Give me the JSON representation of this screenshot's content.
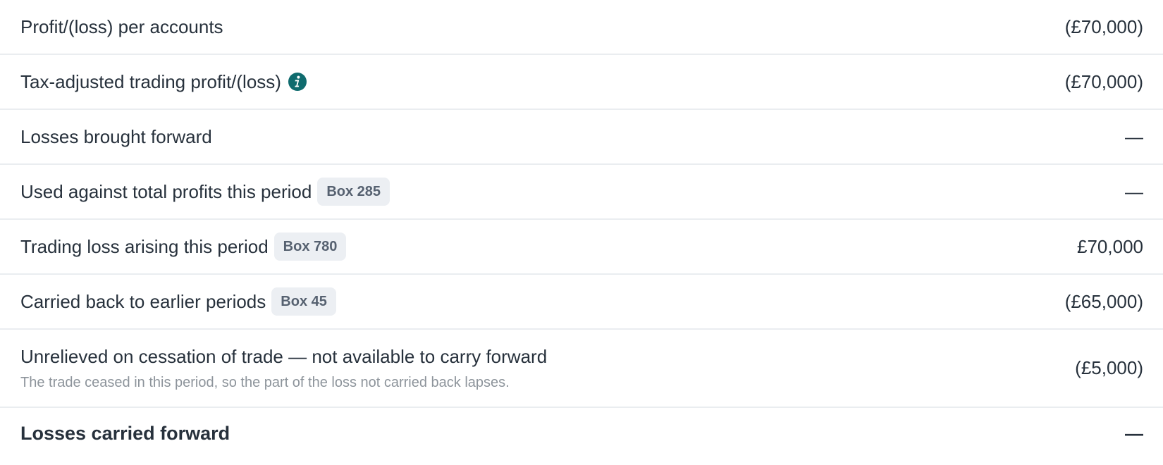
{
  "rows": [
    {
      "label": "Profit/(loss) per accounts",
      "value": "(£70,000)"
    },
    {
      "label": "Tax-adjusted trading profit/(loss)",
      "value": "(£70,000)",
      "icon": "info-icon"
    },
    {
      "label": "Losses brought forward",
      "value": "—"
    },
    {
      "label": "Used against total profits this period",
      "badge": "Box 285",
      "value": "—"
    },
    {
      "label": "Trading loss arising this period",
      "badge": "Box 780",
      "value": "£70,000"
    },
    {
      "label": "Carried back to earlier periods",
      "badge": "Box 45",
      "value": "(£65,000)"
    },
    {
      "label": "Unrelieved on cessation of trade — not available to carry forward",
      "note": "The trade ceased in this period, so the part of the loss not carried back lapses.",
      "value": "(£5,000)"
    },
    {
      "label": "Losses carried forward",
      "value": "—"
    }
  ],
  "colors": {
    "info_icon": "#0f6b6e",
    "badge_bg": "#eceff3",
    "divider": "#eaedf0"
  }
}
